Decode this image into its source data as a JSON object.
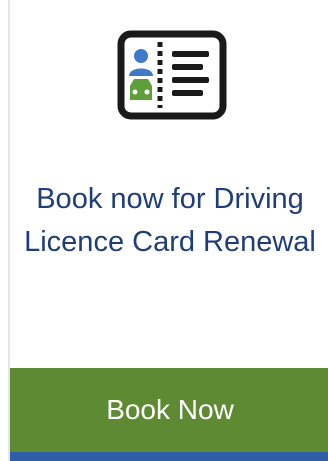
{
  "card": {
    "icon": "id-card-icon",
    "title": "Book now for Driving Licence Card Renewal",
    "button_label": "Book Now"
  },
  "colors": {
    "title_text": "#1f3e78",
    "button_bg": "#5e8a33",
    "bottom_strip": "#2f5da8",
    "icon_person": "#3f79c8",
    "icon_car": "#5e9f3c"
  }
}
